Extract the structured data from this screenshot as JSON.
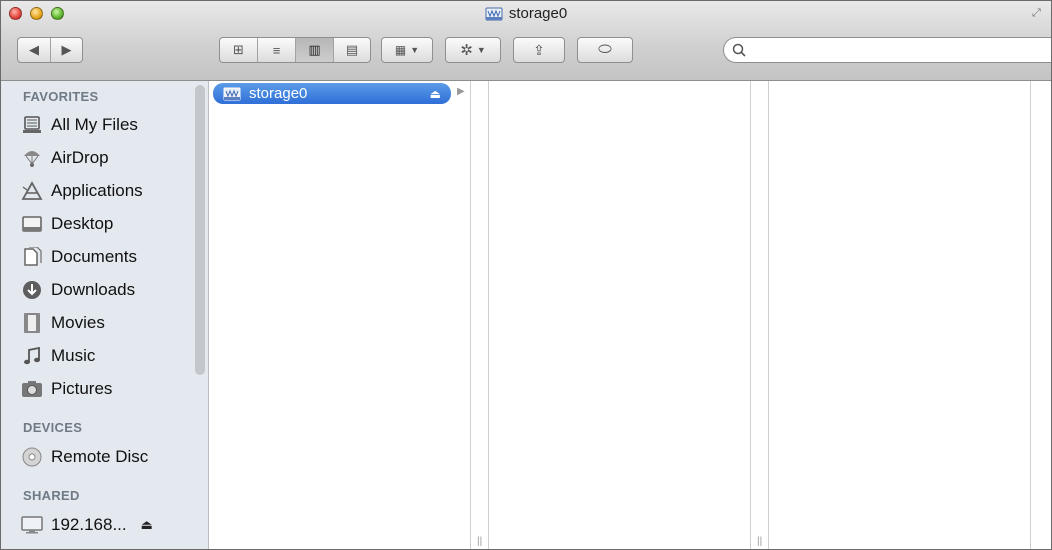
{
  "window": {
    "title": "storage0"
  },
  "toolbar": {
    "back_label": "◀",
    "forward_label": "▶",
    "view_icon": "⊞",
    "list_icon": "≡",
    "column_icon": "▥",
    "coverflow_icon": "▤",
    "arrange_icon": "▦",
    "action_icon": "✲",
    "share_icon": "⇪",
    "toggle_icon": "⬭"
  },
  "search": {
    "placeholder": ""
  },
  "sidebar": {
    "favorites_label": "FAVORITES",
    "favorites": [
      {
        "label": "All My Files",
        "icon": "all-files-icon"
      },
      {
        "label": "AirDrop",
        "icon": "airdrop-icon"
      },
      {
        "label": "Applications",
        "icon": "applications-icon"
      },
      {
        "label": "Desktop",
        "icon": "desktop-icon"
      },
      {
        "label": "Documents",
        "icon": "documents-icon"
      },
      {
        "label": "Downloads",
        "icon": "downloads-icon"
      },
      {
        "label": "Movies",
        "icon": "movies-icon"
      },
      {
        "label": "Music",
        "icon": "music-icon"
      },
      {
        "label": "Pictures",
        "icon": "pictures-icon"
      }
    ],
    "devices_label": "DEVICES",
    "devices": [
      {
        "label": "Remote Disc",
        "icon": "remote-disc-icon"
      }
    ],
    "shared_label": "SHARED",
    "shared": [
      {
        "label": "192.168...",
        "icon": "network-computer-icon"
      }
    ]
  },
  "columns": {
    "first": [
      {
        "label": "storage0",
        "selected": true
      }
    ]
  },
  "colors": {
    "selection": "#2f6fd8",
    "sidebar_bg": "#e4e9ef",
    "section_text": "#6f7a86"
  }
}
